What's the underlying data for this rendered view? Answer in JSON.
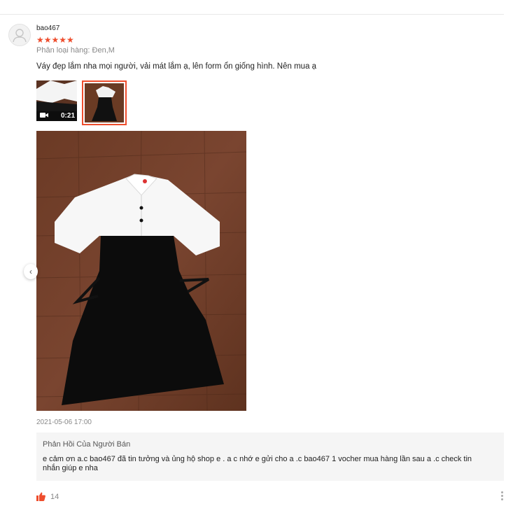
{
  "review": {
    "username": "bao467",
    "rating": "★★★★★",
    "variation": "Phân loại hàng: Đen,M",
    "comment": "Váy đẹp lắm nha mọi người, vải mát lắm ạ, lên form ổn giống hình. Nên mua ạ",
    "media": [
      {
        "type": "video",
        "duration": "0:21",
        "icon": "video-camera-icon"
      },
      {
        "type": "image",
        "selected": true
      }
    ],
    "timestamp": "2021-05-06 17:00"
  },
  "seller_reply": {
    "title": "Phản Hồi Của Người Bán",
    "text": "e cảm ơn a.c bao467 đã tin tưởng và ủng hộ shop e . a c nhớ e gửi cho a .c bao467 1 vocher mua hàng lần sau a .c check tin nhắn giúp e nha"
  },
  "footer": {
    "like_count": "14",
    "like_icon": "thumbs-up-icon",
    "more_icon": "more-vertical-icon"
  },
  "colors": {
    "accent": "#ee4d2d",
    "reply_bg": "#f5f5f5",
    "muted": "#888888"
  }
}
